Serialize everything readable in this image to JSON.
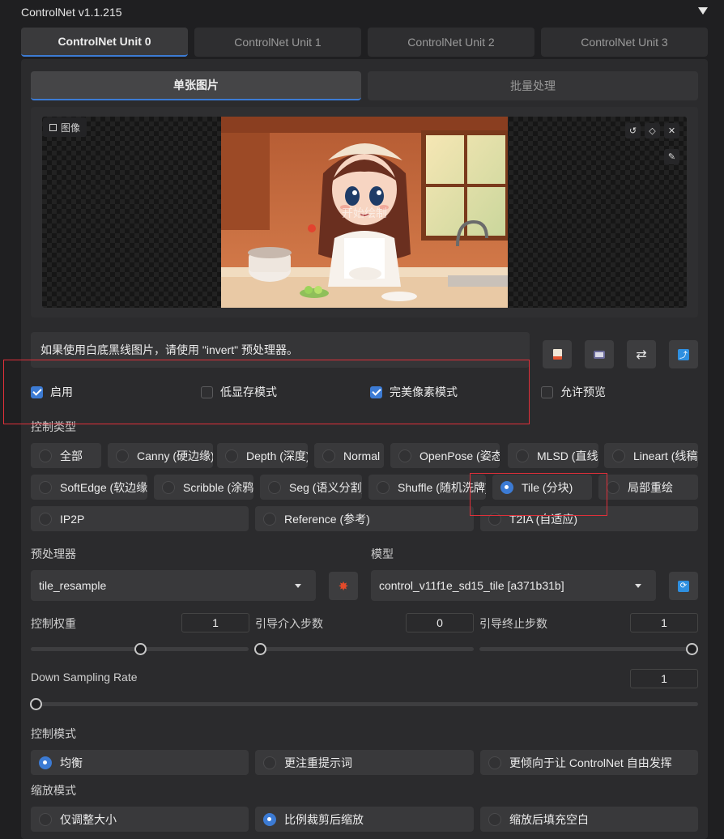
{
  "header": {
    "title": "ControlNet v1.1.215"
  },
  "unit_tabs": [
    {
      "label": "ControlNet Unit 0",
      "active": true
    },
    {
      "label": "ControlNet Unit 1",
      "active": false
    },
    {
      "label": "ControlNet Unit 2",
      "active": false
    },
    {
      "label": "ControlNet Unit 3",
      "active": false
    }
  ],
  "sub_tabs": [
    {
      "label": "单张图片",
      "active": true
    },
    {
      "label": "批量处理",
      "active": false
    }
  ],
  "image": {
    "label": "图像",
    "overlay_text": "开始绘制"
  },
  "info_text": "如果使用白底黑线图片，请使用 \"invert\" 预处理器。",
  "checkboxes": {
    "enable": {
      "label": "启用",
      "checked": true
    },
    "low_vram": {
      "label": "低显存模式",
      "checked": false
    },
    "pixel_perfect": {
      "label": "完美像素模式",
      "checked": true
    },
    "allow_preview": {
      "label": "允许预览",
      "checked": false
    }
  },
  "control_type": {
    "label": "控制类型",
    "options": [
      "全部",
      "Canny (硬边缘)",
      "Depth (深度)",
      "Normal",
      "OpenPose (姿态)",
      "MLSD (直线)",
      "Lineart (线稿)",
      "SoftEdge (软边缘)",
      "Scribble (涂鸦)",
      "Seg (语义分割)",
      "Shuffle (随机洗牌)",
      "Tile (分块)",
      "局部重绘",
      "IP2P",
      "Reference (参考)",
      "T2IA (自适应)"
    ],
    "selected": "Tile (分块)"
  },
  "preprocessor": {
    "label": "预处理器",
    "value": "tile_resample"
  },
  "model": {
    "label": "模型",
    "value": "control_v11f1e_sd15_tile [a371b31b]"
  },
  "sliders": {
    "control_weight": {
      "label": "控制权重",
      "value": "1",
      "fraction": 0.5
    },
    "start_step": {
      "label": "引导介入步数",
      "value": "0",
      "fraction": 0.0
    },
    "end_step": {
      "label": "引导终止步数",
      "value": "1",
      "fraction": 1.0
    },
    "down_sampling": {
      "label": "Down Sampling Rate",
      "value": "1",
      "fraction": 0.0
    }
  },
  "control_mode": {
    "label": "控制模式",
    "options": [
      "均衡",
      "更注重提示词",
      "更倾向于让 ControlNet 自由发挥"
    ],
    "selected": "均衡"
  },
  "resize_mode": {
    "label": "缩放模式",
    "options": [
      "仅调整大小",
      "比例裁剪后缩放",
      "缩放后填充空白"
    ],
    "selected": "比例裁剪后缩放"
  },
  "colors": {
    "accent": "#3c7bd4",
    "highlight_box": "#e0303a"
  }
}
